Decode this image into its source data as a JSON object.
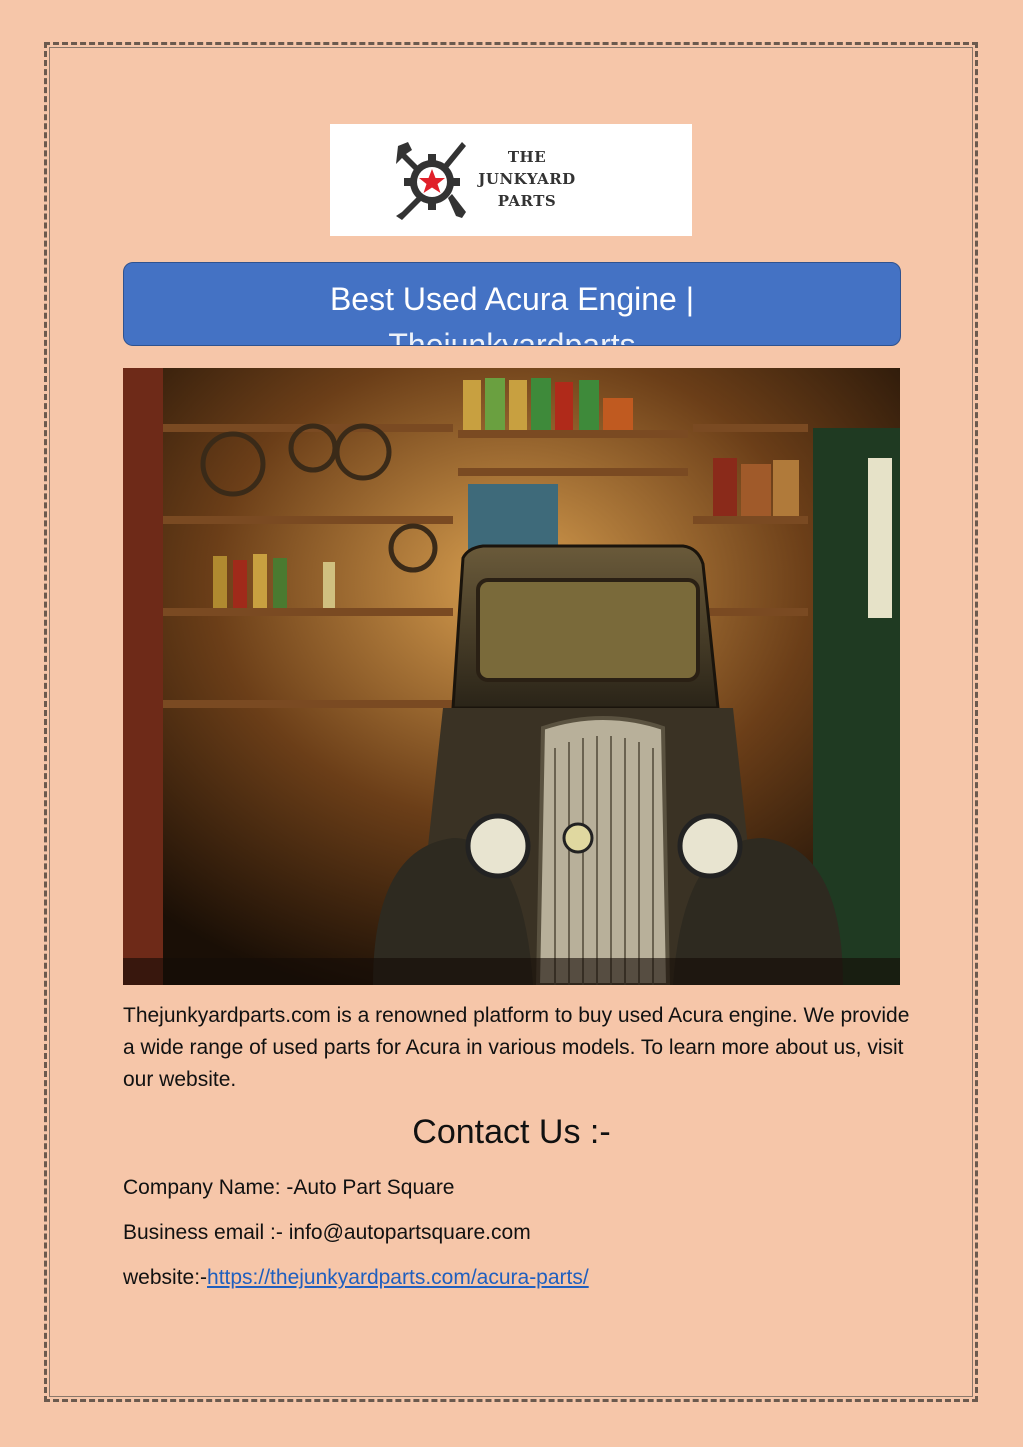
{
  "logo": {
    "line1": "THE",
    "line2": "JUNKYARD",
    "line3": "PARTS",
    "icon": "wrench-gear-star-icon",
    "star_color": "#e0202a"
  },
  "title": {
    "line1": "Best Used Acura Engine |",
    "line2": "Thejunkyardparts"
  },
  "hero_image": {
    "icon": "vintage-car-garage-photo"
  },
  "description": "Thejunkyardparts.com is a renowned platform to buy used Acura engine. We provide a wide range of used parts for Acura in various models. To learn more about us, visit our website.",
  "contact": {
    "heading": "Contact Us :-",
    "company_label": "Company Name: -",
    "company_value": "Auto Part Square",
    "email_label": "Business email :- ",
    "email_value": "info@autopartsquare.com",
    "website_label": "website:-",
    "website_url": "https://thejunkyardparts.com/acura-parts/"
  },
  "colors": {
    "page_bg": "#f6c6a9",
    "banner_bg": "#4472c4",
    "link": "#1f5fbf"
  }
}
